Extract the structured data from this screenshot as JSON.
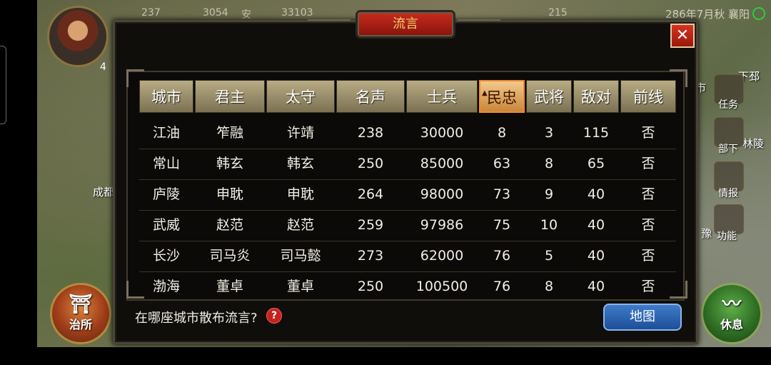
{
  "top_status": {
    "items": [
      "237",
      "3054",
      "安",
      "33103",
      "215"
    ],
    "date": "286年7月秋 襄阳"
  },
  "player": {
    "level": "4"
  },
  "map_labels": {
    "left_city": "成都",
    "right_xiapi": "下邳",
    "right_linling": "林陵",
    "right_yu": "豫",
    "right_shi": "市"
  },
  "side_menu": [
    "任务",
    "部下",
    "情报",
    "功能"
  ],
  "round_buttons": {
    "left": "治所",
    "right": "休息"
  },
  "dialog": {
    "title": "流言",
    "close": "✕",
    "columns": [
      "城市",
      "君主",
      "太守",
      "名声",
      "士兵",
      "民忠",
      "武将",
      "敌对",
      "前线"
    ],
    "active_sort_column": 5,
    "rows": [
      [
        "江油",
        "笮融",
        "许靖",
        "238",
        "30000",
        "8",
        "3",
        "115",
        "否"
      ],
      [
        "常山",
        "韩玄",
        "韩玄",
        "250",
        "85000",
        "63",
        "8",
        "65",
        "否"
      ],
      [
        "庐陵",
        "申耽",
        "申耽",
        "264",
        "98000",
        "73",
        "9",
        "40",
        "否"
      ],
      [
        "武威",
        "赵范",
        "赵范",
        "259",
        "97986",
        "75",
        "10",
        "40",
        "否"
      ],
      [
        "长沙",
        "司马炎",
        "司马懿",
        "273",
        "62000",
        "76",
        "5",
        "40",
        "否"
      ],
      [
        "渤海",
        "董卓",
        "董卓",
        "250",
        "100500",
        "76",
        "8",
        "40",
        "否"
      ]
    ],
    "question": "在哪座城市散布流言?",
    "help": "?",
    "map_button": "地图"
  },
  "colors": {
    "header_bg": "#9d9270",
    "active_header_bg": "#e0a860",
    "title_red": "#b0201a",
    "map_button_blue": "#2d63b0"
  }
}
